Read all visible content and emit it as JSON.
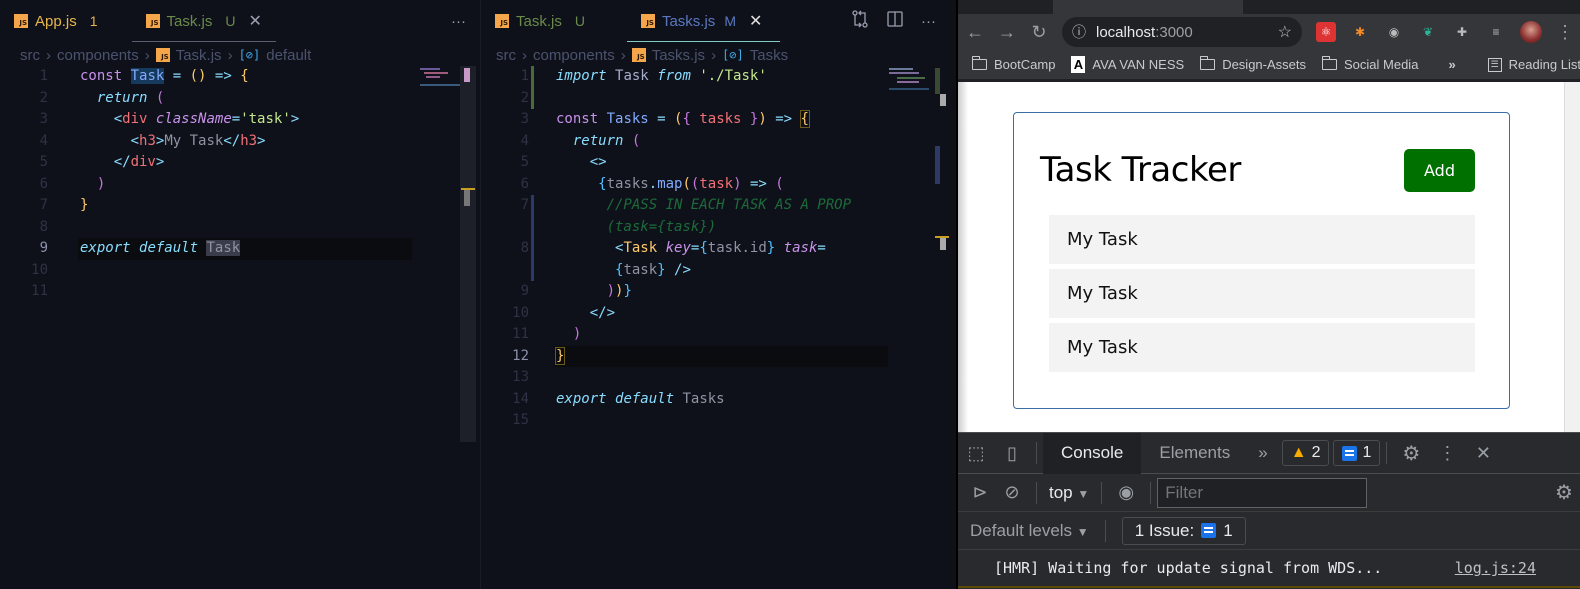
{
  "left_editor": {
    "tabs": [
      {
        "label": "App.js",
        "badge": "1",
        "color": "#e8b54a",
        "active": false
      },
      {
        "label": "Task.js",
        "badge": "U",
        "color": "#6a8a4a",
        "active": true
      }
    ],
    "breadcrumb": [
      "src",
      "components",
      "Task.js",
      "default"
    ],
    "line_numbers": [
      "1",
      "2",
      "3",
      "4",
      "5",
      "6",
      "7",
      "8",
      "9",
      "10",
      "11"
    ],
    "current_line": "9"
  },
  "right_editor": {
    "tabs": [
      {
        "label": "Task.js",
        "badge": "U",
        "color": "#6a8a4a",
        "active": false
      },
      {
        "label": "Tasks.js",
        "badge": "M",
        "color": "#5a78c0",
        "active": true
      }
    ],
    "breadcrumb": [
      "src",
      "components",
      "Tasks.js",
      "Tasks"
    ],
    "line_numbers": [
      "1",
      "2",
      "3",
      "4",
      "5",
      "6",
      "7",
      "",
      "8",
      "",
      "9",
      "10",
      "11",
      "12",
      "13",
      "14",
      "15"
    ],
    "current_line": "12"
  },
  "code_tokens": {
    "const": "const",
    "Task": "Task",
    "Tasks": "Tasks",
    "eq": " = ",
    "arrow_fn": "() => ",
    "lbrace": "{",
    "rbrace": "}",
    "return": "return",
    "lparen": " (",
    "rparen": ")",
    "div_open_lt": "<",
    "div": "div",
    "className": "className",
    "eq2": "=",
    "task_str": "'task'",
    "gt": ">",
    "h3_open": "<",
    "h3": "h3",
    "my_task": "My Task",
    "h3_close": "</",
    "div_close": "</",
    "export": "export",
    "default": "default",
    "import": "import",
    "from": "from",
    "path_str": "'./Task'",
    "tasks_param_open": "({ ",
    "tasks": "tasks",
    "tasks_param_close": " })",
    "arrow": " => ",
    "frag_open": "<>",
    "frag_close": "</>",
    "map_open": "{",
    "tasks_ref": "tasks",
    "dot": ".",
    "map": "map",
    "map_paren": "(",
    "task_param_open": "(",
    "task": "task",
    "task_param_close": ")",
    "comment1": "//PASS IN EACH TASK AS A PROP",
    "comment2": "(task={task})",
    "key": "key",
    "task_id": "task.id",
    "task_attr": "task",
    "self_close": " />",
    "close_map": "))}"
  },
  "editor_actions": {
    "more": "···"
  },
  "browser": {
    "url_host": "localhost",
    "url_port": ":3000",
    "bookmarks": [
      "BootCamp",
      "AVA VAN NESS",
      "Design-Assets",
      "Social Media"
    ],
    "overflow": "»",
    "reading_list": "Reading List",
    "page": {
      "title": "Task Tracker",
      "add_button": "Add",
      "tasks": [
        "My Task",
        "My Task",
        "My Task"
      ],
      "accent": "#007000"
    }
  },
  "devtools": {
    "tabs": [
      "Console",
      "Elements"
    ],
    "more_tabs": "»",
    "warnings": "2",
    "messages": "1",
    "context": "top",
    "filter_placeholder": "Filter",
    "levels": "Default levels",
    "issues_label": "1 Issue:",
    "issues_count": "1",
    "log_message": "[HMR] Waiting for update signal from WDS...",
    "log_source": "log.js:24"
  }
}
